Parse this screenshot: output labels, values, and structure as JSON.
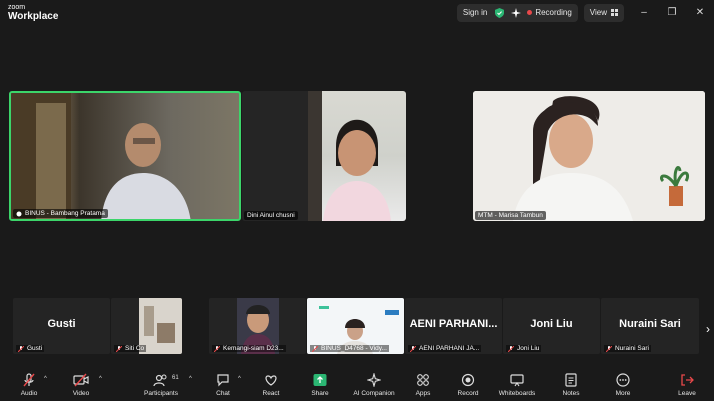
{
  "titlebar": {
    "brand_top": "zoom",
    "brand_bottom": "Workplace",
    "signin_label": "Sign in",
    "recording_label": "Recording",
    "view_label": "View",
    "minimize": "–",
    "maximize": "❐",
    "close": "✕"
  },
  "video_tiles": [
    {
      "name": "BINUS - Bambang Pratama"
    },
    {
      "name": "Dini Ainul chusni"
    },
    {
      "name": "MTM - Marisa Tambun"
    }
  ],
  "participant_strip": [
    {
      "display": "Gusti",
      "label": "Gusti"
    },
    {
      "display": "",
      "label": "Siti Co"
    },
    {
      "display": "",
      "label": "Kemangi-siam D23..."
    },
    {
      "display": "",
      "label": "BINUS_D4768 - Vidy..."
    },
    {
      "display": "AENI PARHANI...",
      "label": "AENI PARHANI JA..."
    },
    {
      "display": "Joni Liu",
      "label": "Joni Liu"
    },
    {
      "display": "Nuraini Sari",
      "label": "Nuraini Sari"
    }
  ],
  "toolbar": {
    "audio": "Audio",
    "video": "Video",
    "participants": "Participants",
    "participants_count": "61",
    "chat": "Chat",
    "react": "React",
    "share": "Share",
    "ai_companion": "AI Companion",
    "apps": "Apps",
    "record": "Record",
    "whiteboards": "Whiteboards",
    "notes": "Notes",
    "more": "More",
    "leave": "Leave"
  },
  "colors": {
    "active_speaker_border": "#3cd56a",
    "recording_dot": "#e8484a",
    "share_green": "#2bb673",
    "muted_red": "#e8484a"
  }
}
